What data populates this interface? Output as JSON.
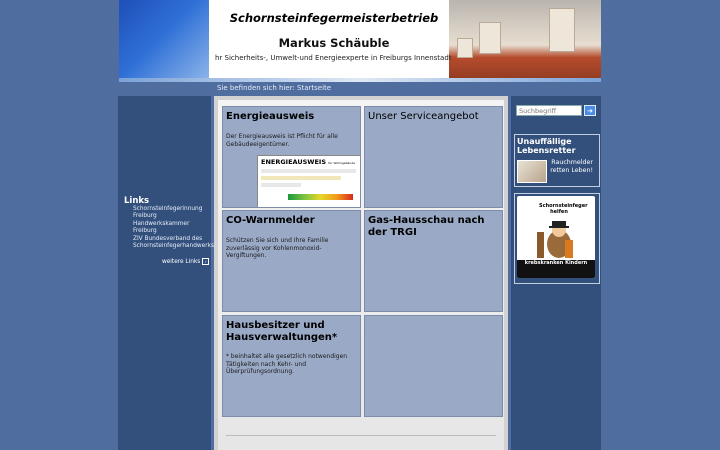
{
  "header": {
    "title": "Schornsteinfegermeisterbetrieb",
    "name": "Markus Schäuble",
    "subtitle": "hr Sicherheits-, Umwelt-und Energieexperte in Freiburgs Innenstadt"
  },
  "breadcrumb": {
    "text": "Sie befinden sich hier: Startseite"
  },
  "sidebar": {
    "heading": "Links",
    "items": [
      {
        "label": "Schornsteinfegerinnung Freiburg"
      },
      {
        "label": "Handwerkskammer Freiburg"
      },
      {
        "label": "ZIV Bundesverband des Schornsteinfegerhandwerks"
      }
    ],
    "more_label": "weitere Links"
  },
  "boxes": {
    "energieausweis": {
      "title": "Energieausweis",
      "text": "Der Energieausweis ist Pflicht für alle Gebäudeeigentümer.",
      "image_title": "ENERGIEAUSWEIS",
      "image_subtitle": "für Wohngebäude"
    },
    "service": {
      "title": "Unser Serviceangebot"
    },
    "co": {
      "title": "CO-Warnmelder",
      "text": "Schützen Sie sich und Ihre Familie zuverlässig vor Kohlenmonoxid-Vergiftungen."
    },
    "gas": {
      "title": "Gas-Hausschau nach der TRGI"
    },
    "hausbesitzer": {
      "title": "Hausbesitzer und Hausverwaltungen*",
      "text": "* beinhaltet alle gesetzlich notwendigen Tätigkeiten nach Kehr- und Überprüfungsordnung."
    }
  },
  "right": {
    "search_placeholder": "Suchbegriff",
    "search_button": "➔",
    "promo_title": "Unauffällige Lebensretter",
    "promo_text": "Rauchmelder retten Leben!",
    "ad_title": "Schornsteinfeger helfen",
    "ad_bottom": "krebskranken Kindern"
  },
  "colors": {
    "background": "#4f6d9f",
    "column": "#33507d",
    "box": "#9aaac6"
  }
}
